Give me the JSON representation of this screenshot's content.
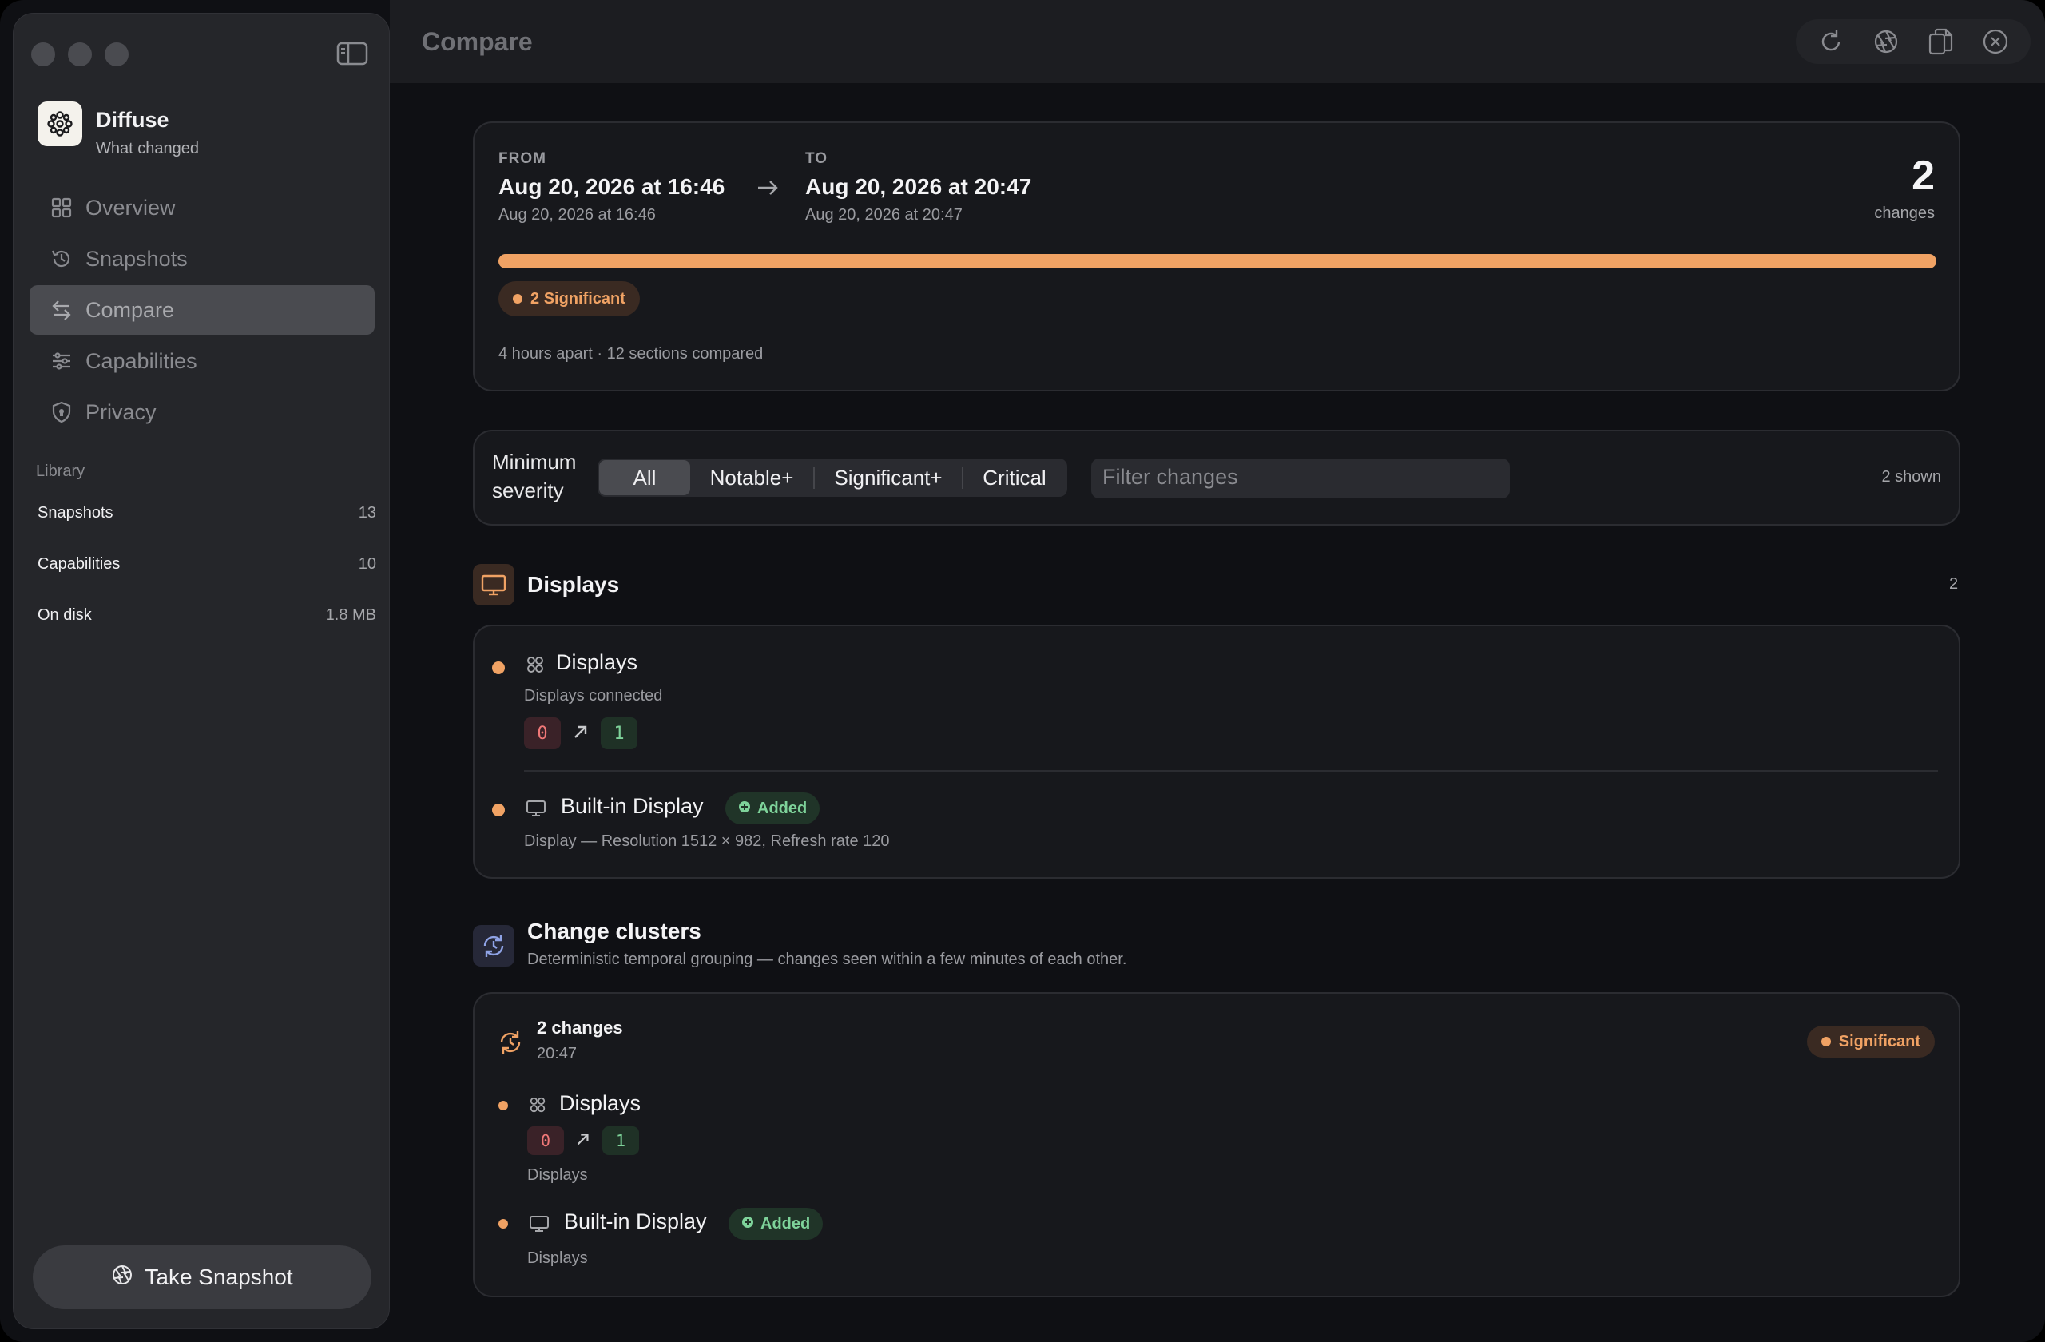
{
  "app": {
    "name": "Diffuse",
    "subtitle": "What changed"
  },
  "toolbar": {
    "title": "Compare",
    "actions": [
      "refresh-icon",
      "aperture-icon",
      "copy-icon",
      "close-icon"
    ]
  },
  "sidebar": {
    "nav": [
      {
        "label": "Overview",
        "icon": "grid-icon",
        "active": false
      },
      {
        "label": "Snapshots",
        "icon": "history-icon",
        "active": false
      },
      {
        "label": "Compare",
        "icon": "arrows-swap-icon",
        "active": true
      },
      {
        "label": "Capabilities",
        "icon": "sliders-icon",
        "active": false
      },
      {
        "label": "Privacy",
        "icon": "shield-icon",
        "active": false
      }
    ],
    "library_title": "Library",
    "library": [
      {
        "label": "Snapshots",
        "value": "13"
      },
      {
        "label": "Capabilities",
        "value": "10"
      },
      {
        "label": "On disk",
        "value": "1.8 MB"
      }
    ],
    "take_snapshot": "Take Snapshot"
  },
  "summary": {
    "from_label": "FROM",
    "from_date": "Aug 20, 2026 at 16:46",
    "from_sub": "Aug 20, 2026 at 16:46",
    "to_label": "TO",
    "to_date": "Aug 20, 2026 at 20:47",
    "to_sub": "Aug 20, 2026 at 20:47",
    "changes_count": "2",
    "changes_label": "changes",
    "significant_count": "2",
    "significant_label": "Significant",
    "progress": 1.0,
    "footer": "4 hours apart · 12 sections compared"
  },
  "filterbar": {
    "severity_label_1": "Minimum",
    "severity_label_2": "severity",
    "options": [
      "All",
      "Notable+",
      "Significant+",
      "Critical"
    ],
    "selected": "All",
    "filter_placeholder": "Filter changes",
    "shown": "2 shown"
  },
  "displays_section": {
    "title": "Displays",
    "count": "2",
    "items": [
      {
        "title": "Displays",
        "desc": "Displays connected",
        "from": "0",
        "to": "1"
      },
      {
        "title": "Built-in Display",
        "badge": "Added",
        "desc": "Display — Resolution 1512 × 982, Refresh rate 120"
      }
    ]
  },
  "clusters_section": {
    "title": "Change clusters",
    "subtitle": "Deterministic temporal grouping — changes seen within a few minutes of each other.",
    "cluster": {
      "count": "2 changes",
      "time": "20:47",
      "severity": "Significant",
      "items": [
        {
          "title": "Displays",
          "from": "0",
          "to": "1",
          "caption": "Displays"
        },
        {
          "title": "Built-in Display",
          "badge": "Added",
          "caption": "Displays"
        }
      ]
    }
  },
  "colors": {
    "accent": "#f0a264",
    "added": "#7ed39a",
    "removed": "#f07878"
  }
}
